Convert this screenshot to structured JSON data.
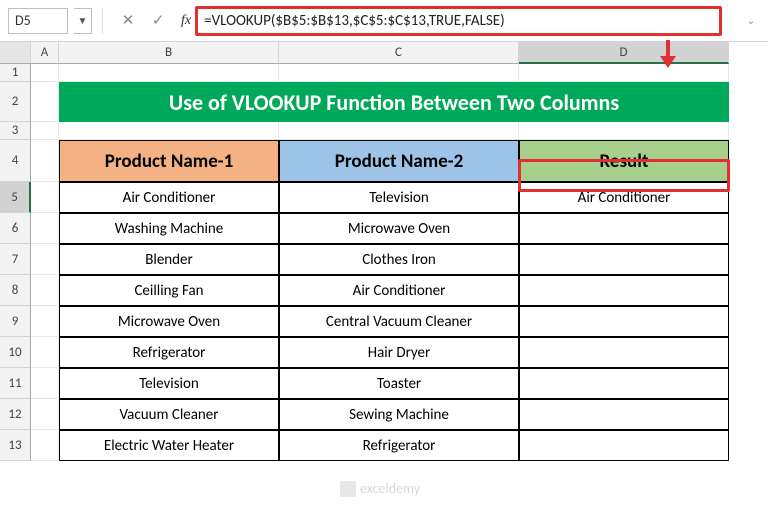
{
  "nameBox": "D5",
  "formula": "=VLOOKUP($B$5:$B$13,$C$5:$C$13,TRUE,FALSE)",
  "columns": [
    "A",
    "B",
    "C",
    "D"
  ],
  "title": "Use of VLOOKUP Function Between Two Columns",
  "headers": {
    "b": "Product Name-1",
    "c": "Product Name-2",
    "d": "Result"
  },
  "rows": [
    {
      "n": "5",
      "b": "Air Conditioner",
      "c": "Television",
      "d": "Air Conditioner"
    },
    {
      "n": "6",
      "b": "Washing Machine",
      "c": "Microwave Oven",
      "d": ""
    },
    {
      "n": "7",
      "b": "Blender",
      "c": "Clothes Iron",
      "d": ""
    },
    {
      "n": "8",
      "b": "Ceilling Fan",
      "c": "Air Conditioner",
      "d": ""
    },
    {
      "n": "9",
      "b": "Microwave Oven",
      "c": "Central Vacuum Cleaner",
      "d": ""
    },
    {
      "n": "10",
      "b": "Refrigerator",
      "c": "Hair Dryer",
      "d": ""
    },
    {
      "n": "11",
      "b": "Television",
      "c": "Toaster",
      "d": ""
    },
    {
      "n": "12",
      "b": "Vacuum Cleaner",
      "c": "Sewing Machine",
      "d": ""
    },
    {
      "n": "13",
      "b": "Electric Water Heater",
      "c": "Refrigerator",
      "d": ""
    }
  ],
  "watermark": "exceldemy"
}
